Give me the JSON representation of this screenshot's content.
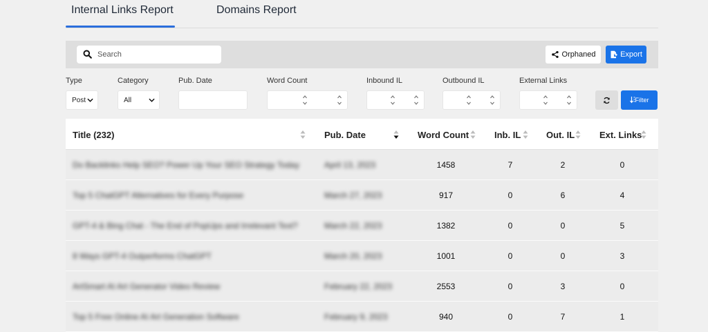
{
  "tabs": [
    {
      "label": "Internal Links Report",
      "active": true
    },
    {
      "label": "Domains Report",
      "active": false
    }
  ],
  "toolbar": {
    "search_placeholder": "Search",
    "orphaned_label": "Orphaned",
    "export_label": "Export"
  },
  "filters": {
    "type": {
      "label": "Type",
      "value": "Post"
    },
    "category": {
      "label": "Category",
      "value": "All"
    },
    "pub_date": {
      "label": "Pub. Date"
    },
    "word_count": {
      "label": "Word Count"
    },
    "inbound": {
      "label": "Inbound IL"
    },
    "outbound": {
      "label": "Outbound IL"
    },
    "external": {
      "label": "External Links"
    },
    "filter_label": "Filter"
  },
  "table": {
    "headers": {
      "title": "Title (232)",
      "pub_date": "Pub. Date",
      "word_count": "Word Count",
      "inb": "Inb. IL",
      "out": "Out. IL",
      "ext": "Ext. Links"
    },
    "rows": [
      {
        "title": "Do Backlinks Help SEO? Power Up Your SEO Strategy Today",
        "date": "April 13, 2023",
        "words": "1458",
        "inb": "7",
        "out": "2",
        "ext": "0"
      },
      {
        "title": "Top 5 ChatGPT Alternatives for Every Purpose",
        "date": "March 27, 2023",
        "words": "917",
        "inb": "0",
        "out": "6",
        "ext": "4"
      },
      {
        "title": "GPT-4 & Bing Chat - The End of PopUps and Irrelevant Text?",
        "date": "March 22, 2023",
        "words": "1382",
        "inb": "0",
        "out": "0",
        "ext": "5"
      },
      {
        "title": "8 Ways GPT-4 Outperforms ChatGPT",
        "date": "March 20, 2023",
        "words": "1001",
        "inb": "0",
        "out": "0",
        "ext": "3"
      },
      {
        "title": "ArtSmart AI Art Generator Video Review",
        "date": "February 22, 2023",
        "words": "2553",
        "inb": "0",
        "out": "3",
        "ext": "0"
      },
      {
        "title": "Top 5 Free Online AI Art Generation Software",
        "date": "February 9, 2023",
        "words": "940",
        "inb": "0",
        "out": "7",
        "ext": "1"
      }
    ]
  }
}
